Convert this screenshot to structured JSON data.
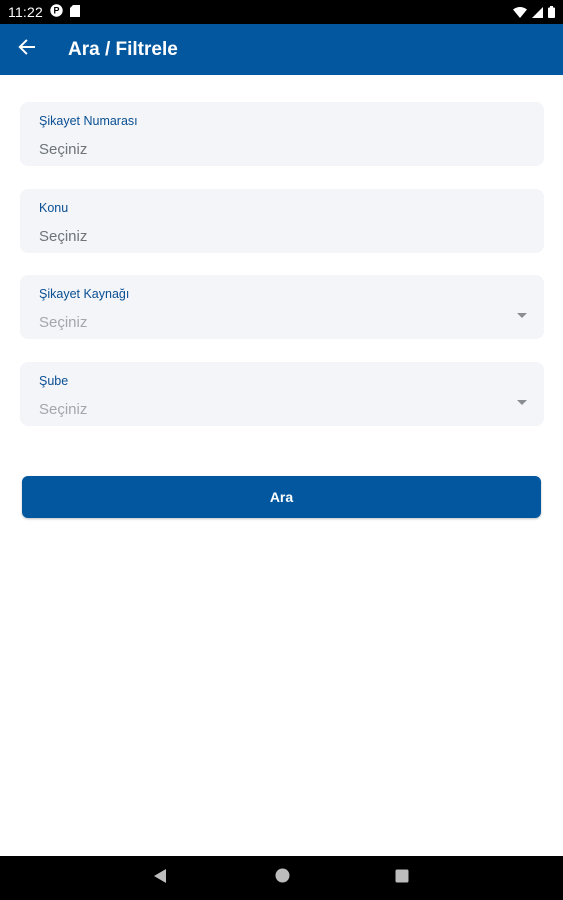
{
  "status_bar": {
    "time": "11:22",
    "icons": [
      "notification-p-icon",
      "sd-card-icon",
      "wifi-icon",
      "signal-icon",
      "battery-icon"
    ]
  },
  "app_bar": {
    "title": "Ara / Filtrele",
    "back_icon": "arrow-back-icon"
  },
  "form": {
    "fields": [
      {
        "label": "Şikayet Numarası",
        "value": "Seçiniz",
        "type": "text"
      },
      {
        "label": "Konu",
        "value": "Seçiniz",
        "type": "text"
      },
      {
        "label": "Şikayet Kaynağı",
        "value": "Seçiniz",
        "type": "dropdown"
      },
      {
        "label": "Şube",
        "value": "Seçiniz",
        "type": "dropdown"
      }
    ]
  },
  "search_button": {
    "label": "Ara"
  },
  "nav_bar": {
    "icons": [
      "back-triangle-icon",
      "home-circle-icon",
      "recents-square-icon"
    ]
  },
  "colors": {
    "primary": "#02579f",
    "field_background": "#f3f5f8",
    "label": "#0a4f93"
  }
}
